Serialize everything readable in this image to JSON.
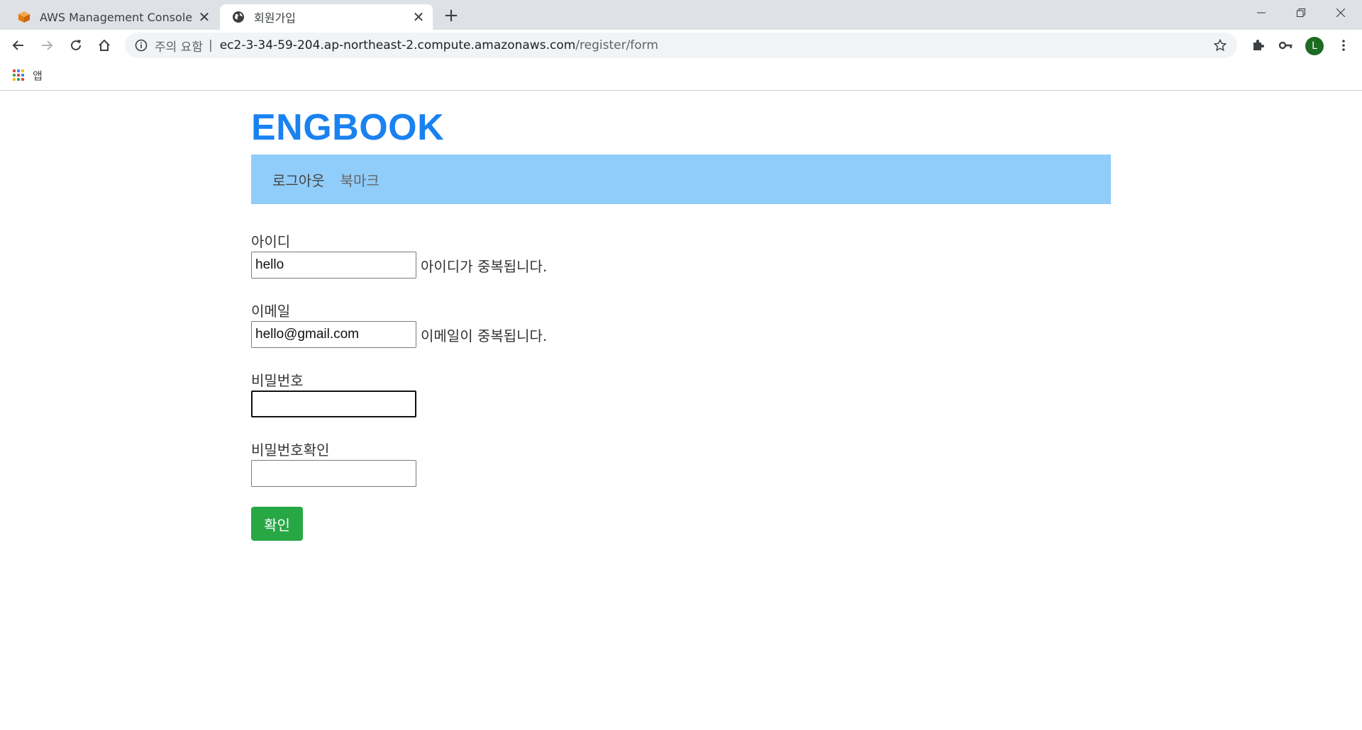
{
  "browser": {
    "tabs": [
      {
        "title": "AWS Management Console",
        "active": false
      },
      {
        "title": "회원가입",
        "active": true
      }
    ],
    "address": {
      "security_label": "주의 요함",
      "separator": "|",
      "host": "ec2-3-34-59-204.ap-northeast-2.compute.amazonaws.com",
      "path": "/register/form"
    },
    "profile_initial": "L",
    "bookmarks": {
      "apps_label": "앱"
    }
  },
  "site": {
    "brand": "ENGBOOK",
    "nav": {
      "logout": "로그아웃",
      "bookmark": "북마크"
    }
  },
  "form": {
    "username": {
      "label": "아이디",
      "value": "hello",
      "message": "아이디가 중복됩니다."
    },
    "email": {
      "label": "이메일",
      "value": "hello@gmail.com",
      "message": "이메일이 중복됩니다."
    },
    "password": {
      "label": "비밀번호",
      "value": ""
    },
    "password_confirm": {
      "label": "비밀번호확인",
      "value": ""
    },
    "submit_label": "확인"
  },
  "colors": {
    "brand": "#1a82f0",
    "navbar": "#90cdfa",
    "submit": "#28a745",
    "aws_icon": "#f38b1f"
  }
}
